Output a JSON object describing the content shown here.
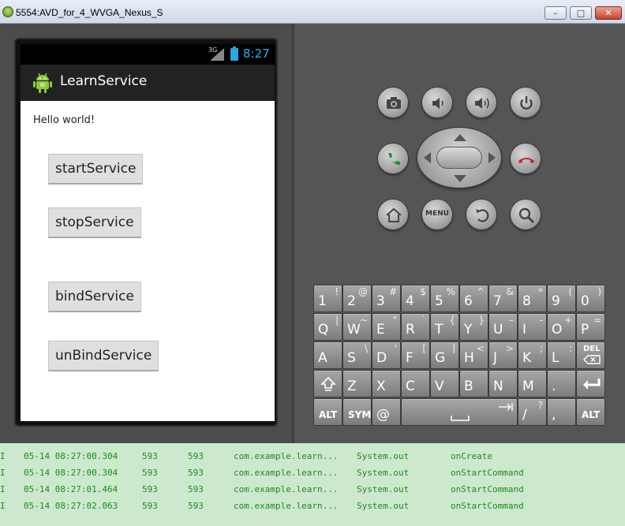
{
  "window": {
    "title": "5554:AVD_for_4_WVGA_Nexus_S"
  },
  "status_bar": {
    "network": "3G",
    "time": "8:27"
  },
  "app": {
    "name": "LearnService",
    "hello": "Hello world!",
    "buttons": [
      "startService",
      "stopService",
      "bindService",
      "unBindService"
    ]
  },
  "controls": {
    "menu_label": "MENU"
  },
  "keyboard": {
    "row1": [
      [
        "1",
        "!"
      ],
      [
        "2",
        "@"
      ],
      [
        "3",
        "#"
      ],
      [
        "4",
        "$"
      ],
      [
        "5",
        "%"
      ],
      [
        "6",
        "^"
      ],
      [
        "7",
        "&"
      ],
      [
        "8",
        "*"
      ],
      [
        "9",
        "("
      ],
      [
        "0",
        ")"
      ]
    ],
    "row2": [
      [
        "Q",
        "|"
      ],
      [
        "W",
        "~"
      ],
      [
        "E",
        "\""
      ],
      [
        "R",
        "`"
      ],
      [
        "T",
        "{"
      ],
      [
        "Y",
        "}"
      ],
      [
        "U",
        "–"
      ],
      [
        "I",
        "-"
      ],
      [
        "O",
        "+"
      ],
      [
        "P",
        "="
      ]
    ],
    "row3": [
      [
        "A",
        ""
      ],
      [
        "S",
        "\\"
      ],
      [
        "D",
        "'"
      ],
      [
        "F",
        "["
      ],
      [
        "G",
        "]"
      ],
      [
        "H",
        "<"
      ],
      [
        "J",
        ">"
      ],
      [
        "K",
        ";"
      ],
      [
        "L",
        ":"
      ]
    ],
    "row3_del": "DEL",
    "row4": [
      [
        "Z",
        ""
      ],
      [
        "X",
        ""
      ],
      [
        "C",
        ""
      ],
      [
        "V",
        ""
      ],
      [
        "B",
        ""
      ],
      [
        "N",
        ""
      ],
      [
        "M",
        ""
      ],
      [
        ".",
        ""
      ]
    ],
    "row5": {
      "alt": "ALT",
      "sym": "SYM",
      "at": "@",
      "slash": "/",
      "question": "?",
      "comma": ",",
      "alt2": "ALT"
    }
  },
  "logcat": [
    [
      "I",
      "05-14 08:27:00.304",
      "593",
      "593",
      "com.example.learn...",
      "System.out",
      "onCreate"
    ],
    [
      "I",
      "05-14 08:27:00.304",
      "593",
      "593",
      "com.example.learn...",
      "System.out",
      "onStartCommand"
    ],
    [
      "I",
      "05-14 08:27:01.464",
      "593",
      "593",
      "com.example.learn...",
      "System.out",
      "onStartCommand"
    ],
    [
      "I",
      "05-14 08:27:02.063",
      "593",
      "593",
      "com.example.learn...",
      "System.out",
      "onStartCommand"
    ]
  ]
}
